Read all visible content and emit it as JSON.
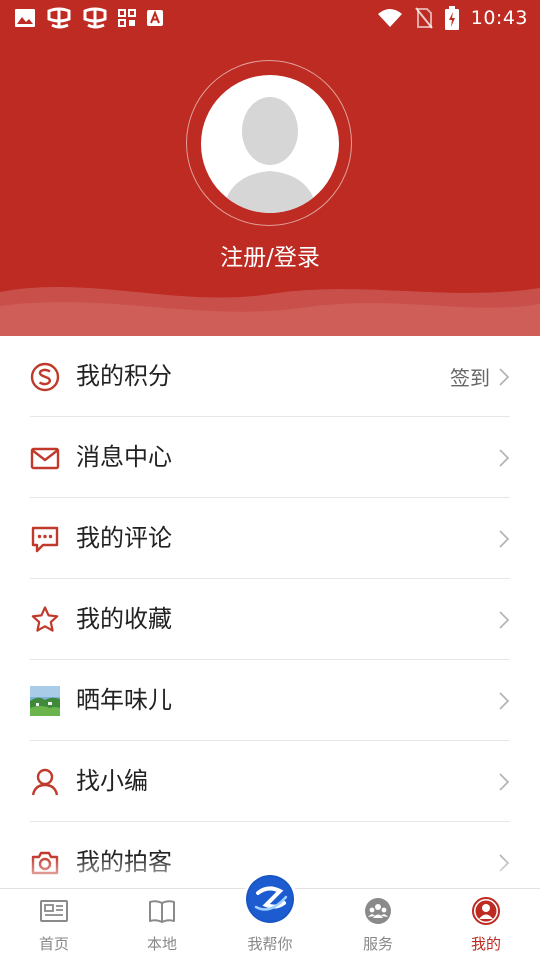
{
  "status_bar": {
    "time": "10:43",
    "left_icons": [
      "image-icon",
      "app-icon",
      "app-icon",
      "grid-icon",
      "a-icon"
    ],
    "right_icons": [
      "wifi-icon",
      "no-sim-icon",
      "battery-charging-icon"
    ]
  },
  "header": {
    "background": "#bd2b22",
    "login_label": "注册/登录"
  },
  "menu": {
    "items": [
      {
        "label": "我的积分",
        "icon": "points-icon",
        "right_text": "签到"
      },
      {
        "label": "消息中心",
        "icon": "mail-icon"
      },
      {
        "label": "我的评论",
        "icon": "comment-icon"
      },
      {
        "label": "我的收藏",
        "icon": "star-icon"
      },
      {
        "label": "晒年味儿",
        "icon": "photo-thumbnail-icon"
      },
      {
        "label": "找小编",
        "icon": "person-icon"
      },
      {
        "label": "我的拍客",
        "icon": "camera-icon"
      }
    ]
  },
  "tabbar": {
    "accent": "#bd2b22",
    "tabs": [
      {
        "label": "首页",
        "icon": "news-icon"
      },
      {
        "label": "本地",
        "icon": "book-icon"
      },
      {
        "label": "我帮你",
        "icon": "help-logo-icon"
      },
      {
        "label": "服务",
        "icon": "service-icon"
      },
      {
        "label": "我的",
        "icon": "profile-icon",
        "active": true
      }
    ]
  }
}
